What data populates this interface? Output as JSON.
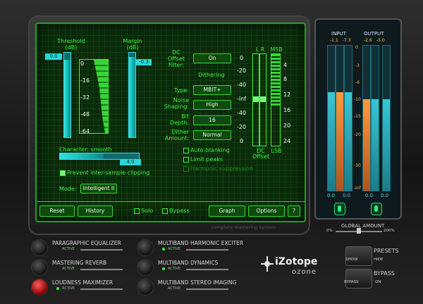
{
  "panel": {
    "threshold_label": "Threshold",
    "threshold_unit": "(dB)",
    "threshold_value": "0.0",
    "threshold_fill": 0.92,
    "margin_label": "Margin",
    "margin_unit": "(dB)",
    "margin_value": "-0.3",
    "scale": [
      "0",
      "-16",
      "-32",
      "-48",
      "-64"
    ],
    "character_label": "Character: smooth",
    "character_value": "4.0",
    "character_fill": 0.55,
    "prevent_clip_label": "Prevent inter-sample clipping",
    "mode_label": "Mode:",
    "mode_value": "Intelligent II",
    "dc_label1": "DC",
    "dc_label2": "Offset",
    "dc_label3": "Filter:",
    "dc_value": "On",
    "dithering_label": "Dithering",
    "type_label": "Type:",
    "type_value": "MBIT+",
    "noise_label1": "Noise",
    "noise_label2": "Shaping:",
    "noise_value": "High",
    "bit_label1": "Bit",
    "bit_label2": "Depth:",
    "bit_value": "16",
    "dither_label1": "Dither",
    "dither_label2": "Amount:",
    "dither_value": "Normal",
    "autoblanking": "Auto-blanking",
    "limit_peaks": "Limit peaks",
    "harmonic_suppression": "Harmonic suppression",
    "lr_label": "L R",
    "dc_offset_label1": "DC",
    "dc_offset_label2": "Offset",
    "db_scale": [
      "0",
      "-20",
      "-40",
      "-inf",
      "-40",
      "-20",
      "0"
    ],
    "msb_label": "MSB",
    "lsb_label": "LSB",
    "bit_scale": [
      "4",
      "8",
      "12",
      "16",
      "20",
      "24"
    ],
    "reset": "Reset",
    "history": "History",
    "solo": "Solo",
    "bypass": "Bypass",
    "graph": "Graph",
    "options": "Options",
    "help": "?"
  },
  "footer_text": "complete mastering system",
  "meters": {
    "input_label": "INPUT",
    "output_label": "OUTPUT",
    "input_peaks": [
      "-1.1",
      "-7.3"
    ],
    "output_peaks": [
      "-2.6",
      "-5.0"
    ],
    "scale": [
      "0",
      "-3",
      "-6",
      "-10",
      "-15",
      "-20",
      "-30",
      "-inf"
    ],
    "bottom_values": [
      "0.0",
      "0.0",
      "0.0",
      "0.0"
    ],
    "input_levels": [
      0.68,
      0.68
    ],
    "output_levels": [
      0.63,
      0.63
    ]
  },
  "global_amount": {
    "label": "GLOBAL AMOUNT",
    "min": "0%",
    "max": "200%",
    "value": 0.5
  },
  "modules": [
    {
      "name": "PARAGRAPHIC EQUALIZER",
      "sub": "ACTIVE",
      "active": false
    },
    {
      "name": "MASTERING REVERB",
      "sub": "ACTIVE",
      "active": false
    },
    {
      "name": "LOUDNESS MAXIMIZER",
      "sub": "ACTIVE",
      "active": true
    },
    {
      "name": "MULTIBAND HARMONIC EXCITER",
      "sub": "ACTIVE",
      "active": true
    },
    {
      "name": "MULTIBAND DYNAMICS",
      "sub": "ACTIVE",
      "active": true
    },
    {
      "name": "MULTIBAND STEREO IMAGING",
      "sub": "ACTIVE",
      "active": false
    }
  ],
  "logo": {
    "brand": "iZotope",
    "product": "ozone"
  },
  "presets": {
    "label": "PRESETS",
    "show": "SHOW",
    "hide": "HIDE"
  },
  "bypass": {
    "label": "BYPASS",
    "bypass": "BYPASS",
    "on": "ON"
  }
}
